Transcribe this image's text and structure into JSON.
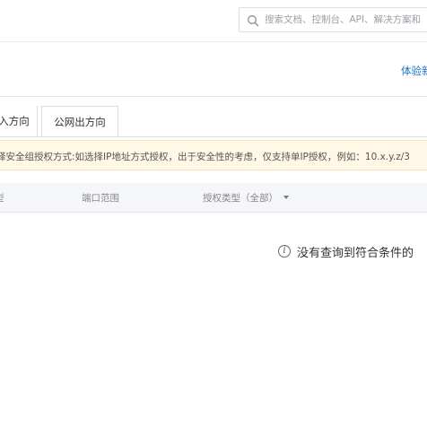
{
  "header": {
    "search_placeholder": "搜索文档、控制台、API、解决方案和"
  },
  "subbar": {
    "trial_link": "体验新"
  },
  "tabs": [
    {
      "label": "入方向"
    },
    {
      "label": "公网出方向"
    }
  ],
  "notice": {
    "text": "择安全组授权方式:如选择IP地址方式授权，出于安全性的考虑，仅支持单IP授权，例如：10.x.y.z/3"
  },
  "table": {
    "columns": [
      {
        "label": "型"
      },
      {
        "label": "端口范围"
      },
      {
        "label": "授权类型（全部）"
      }
    ]
  },
  "empty_state": {
    "text": "没有查询到符合条件的"
  }
}
